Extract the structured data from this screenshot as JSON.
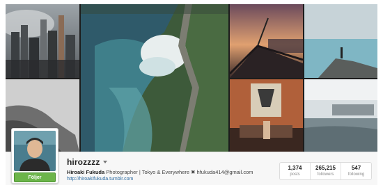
{
  "profile": {
    "username": "hirozzzz",
    "follow_label": "Följer",
    "full_name": "Hiroaki Fukuda",
    "bio": "Photographer | Tokyo & Everywhere ✖ hfukuda414@gmail.com",
    "website": "http://hiroakifukuda.tumblr.com"
  },
  "stats": [
    {
      "value": "1,374",
      "label": "posts"
    },
    {
      "value": "265,215",
      "label": "followers"
    },
    {
      "value": "547",
      "label": "following"
    }
  ],
  "icons": {
    "dropdown": "chevron-down-icon"
  },
  "colors": {
    "follow_button": "#6cb54a",
    "link": "#2c6aa0"
  }
}
